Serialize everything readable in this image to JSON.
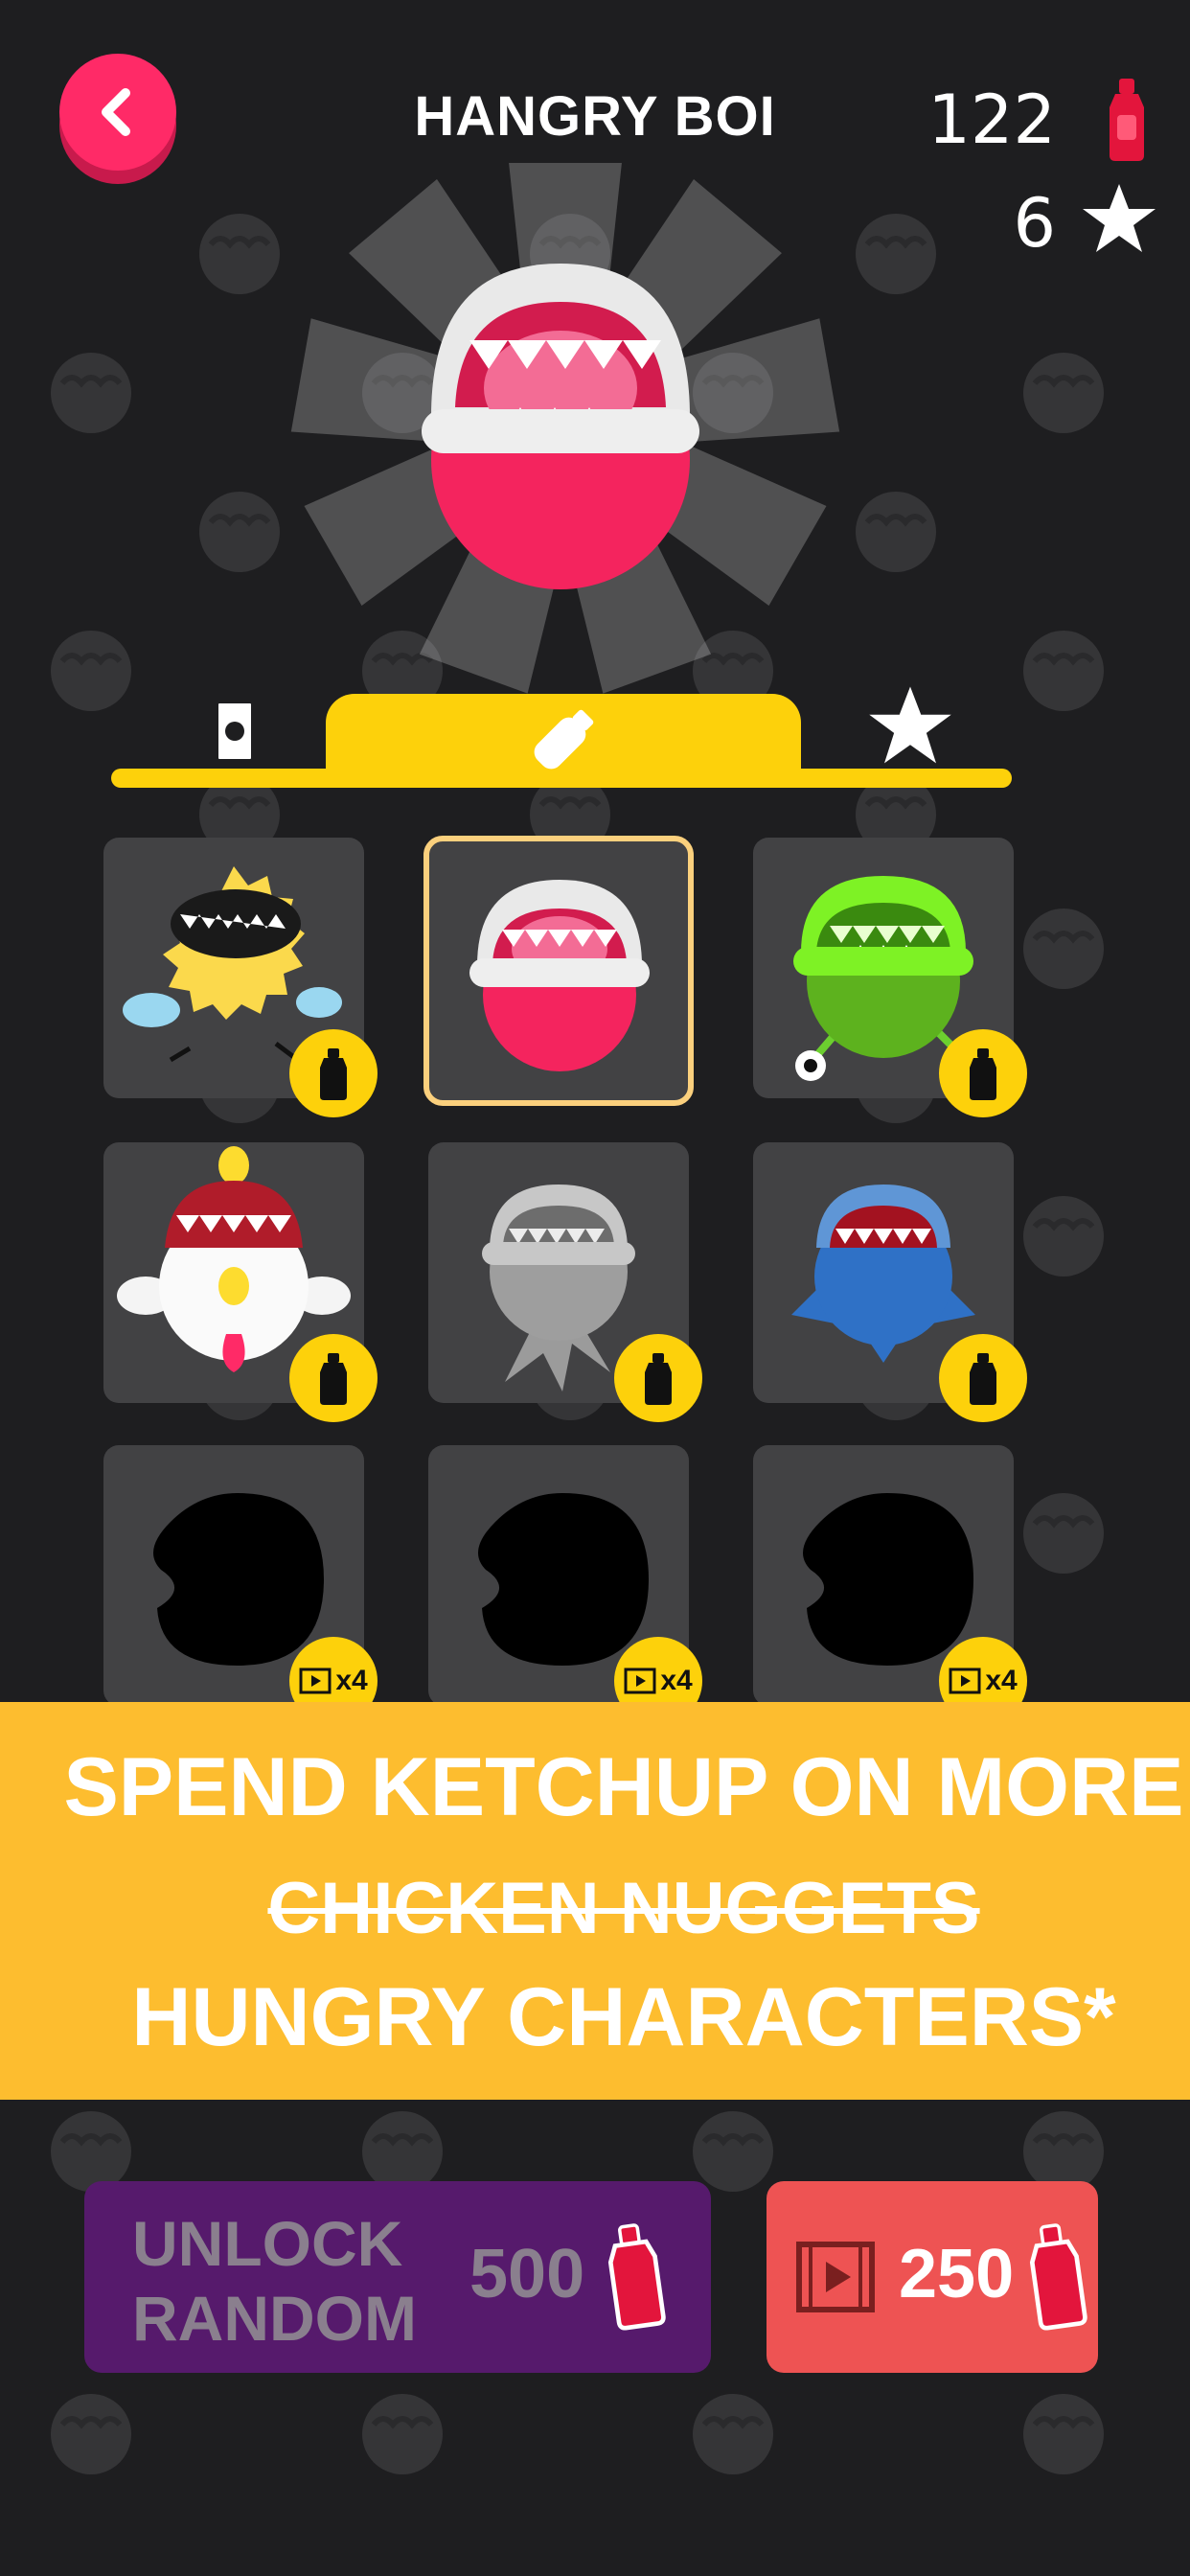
{
  "header": {
    "title": "HANGRY BOI",
    "ketchup_count": "122",
    "star_count": "6"
  },
  "tabs": [
    {
      "icon": "cash-icon",
      "active": false
    },
    {
      "icon": "bottle-icon",
      "active": true
    },
    {
      "icon": "star-icon",
      "active": false
    }
  ],
  "grid": [
    {
      "name": "yellow-fluffy-character",
      "badge": "bottle-icon"
    },
    {
      "name": "hangry-boi-character",
      "selected": true
    },
    {
      "name": "green-plant-character",
      "badge": "bottle-icon"
    },
    {
      "name": "chicken-character",
      "badge": "bottle-icon"
    },
    {
      "name": "gray-squid-character",
      "badge": "bottle-icon"
    },
    {
      "name": "blue-shark-character",
      "badge": "bottle-icon"
    },
    {
      "name": "locked-character-silhouette",
      "badge_label": "x4"
    },
    {
      "name": "locked-character-silhouette",
      "badge_label": "x4"
    },
    {
      "name": "locked-character-silhouette",
      "badge_label": "x4"
    }
  ],
  "banner": {
    "line1": "SPEND KETCHUP ON MORE",
    "line2": "CHICKEN NUGGETS",
    "line3": "HUNGRY CHARACTERS*"
  },
  "buttons": {
    "unlock_line1": "UNLOCK",
    "unlock_line2": "RANDOM",
    "unlock_price": "500",
    "ad_price": "250"
  },
  "colors": {
    "background": "#1e1e20",
    "accent_pink": "#ff2a67",
    "accent_yellow": "#fdd10b",
    "banner": "#fdbd2f",
    "unlock_purple": "#561a6c",
    "ad_red": "#ee5353"
  }
}
